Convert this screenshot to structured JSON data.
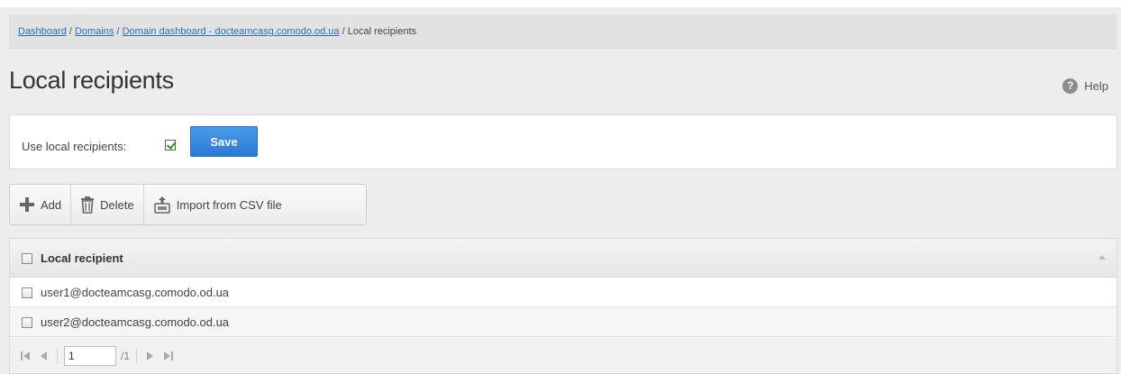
{
  "breadcrumb": {
    "items": [
      {
        "label": "Dashboard",
        "link": true
      },
      {
        "label": "Domains",
        "link": true
      },
      {
        "label": "Domain dashboard - docteamcasg.comodo.od.ua",
        "link": true
      },
      {
        "label": "Local recipients",
        "link": false
      }
    ],
    "separator": "/"
  },
  "page": {
    "title": "Local recipients",
    "help_label": "Help",
    "help_icon": "question-circle-icon"
  },
  "settings": {
    "use_local_label": "Use local recipients:",
    "use_local_checked": true,
    "save_label": "Save"
  },
  "toolbar": {
    "add_label": "Add",
    "delete_label": "Delete",
    "import_label": "Import from CSV file"
  },
  "grid": {
    "header": "Local recipient",
    "rows": [
      "user1@docteamcasg.comodo.od.ua",
      "user2@docteamcasg.comodo.od.ua"
    ]
  },
  "pager": {
    "page_value": "1",
    "total_pages": "/1"
  },
  "colors": {
    "accent": "#2a79d3",
    "link": "#2a6fb8",
    "background": "#ededed"
  }
}
